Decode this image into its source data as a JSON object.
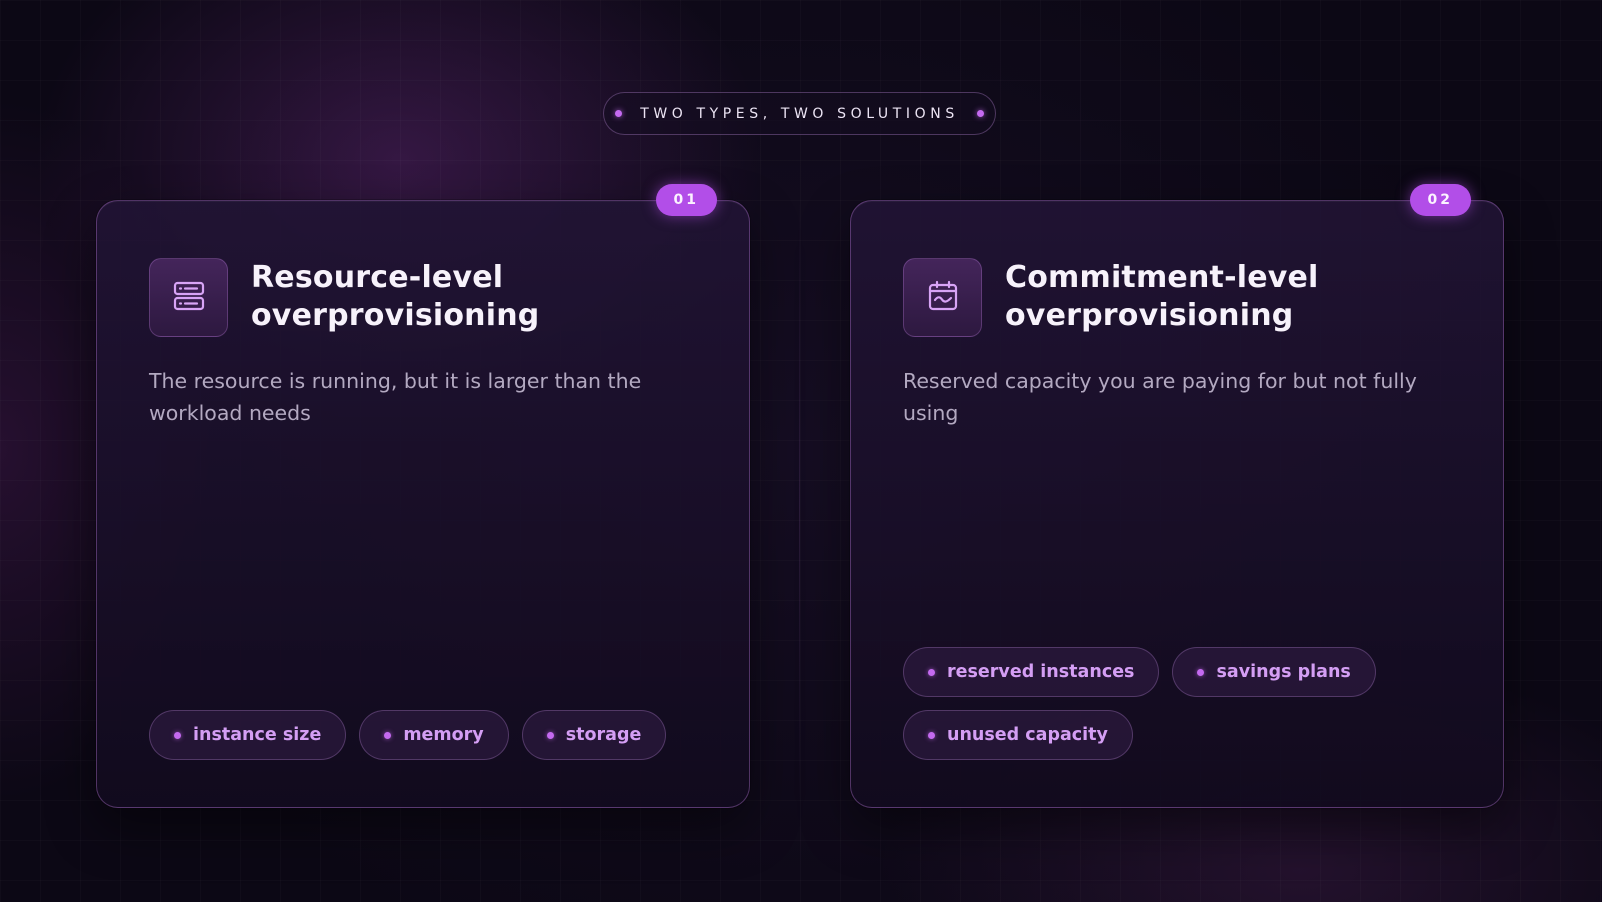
{
  "header": {
    "eyebrow": "TWO TYPES, TWO SOLUTIONS"
  },
  "cards": [
    {
      "number": "01",
      "icon": "server-icon",
      "title_line1": "Resource-level",
      "title_line2": "overprovisioning",
      "description": "The resource is running, but it is larger than the workload needs",
      "tags": [
        "instance size",
        "memory",
        "storage"
      ]
    },
    {
      "number": "02",
      "icon": "calendar-icon",
      "title_line1": "Commitment-level",
      "title_line2": "overprovisioning",
      "description": "Reserved capacity you are paying for but not fully using",
      "tags": [
        "reserved instances",
        "savings plans",
        "unused capacity"
      ]
    }
  ],
  "colors": {
    "accent": "#b24ee8",
    "tag_text": "#d49ef4",
    "background": "#0c0815"
  }
}
